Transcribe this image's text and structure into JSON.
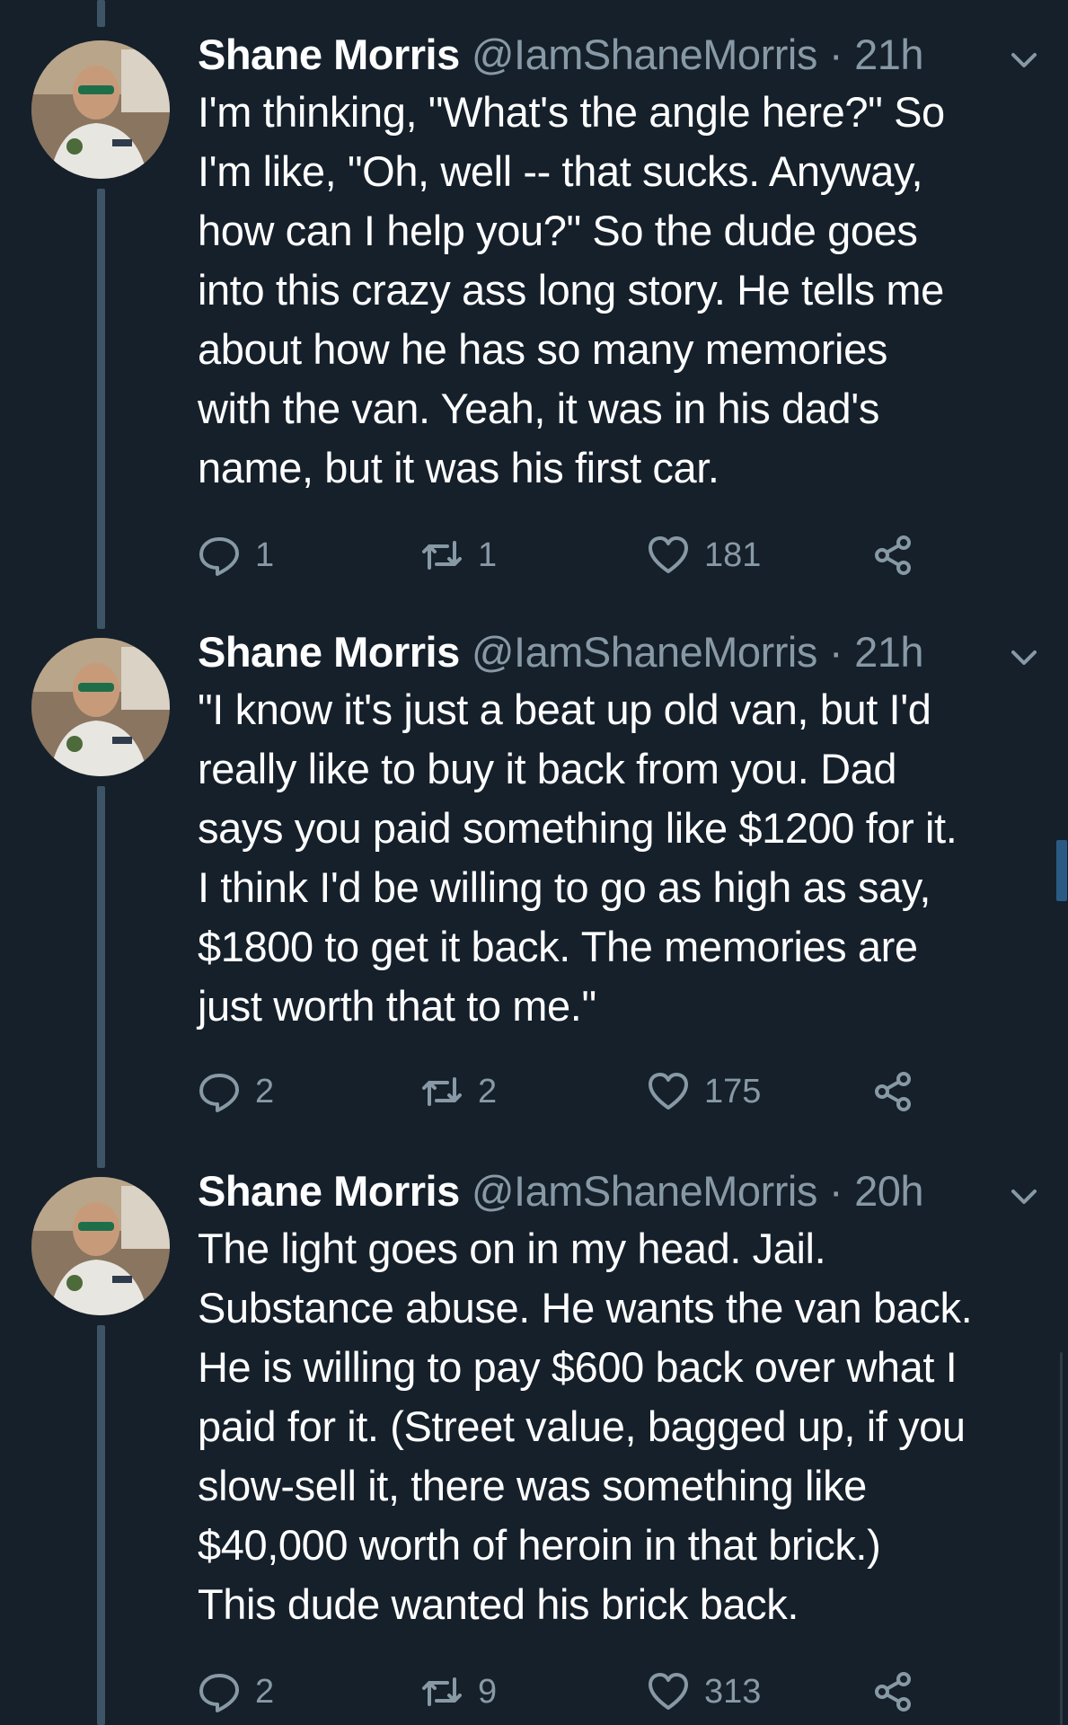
{
  "colors": {
    "background": "#15202b",
    "text": "#ffffff",
    "muted": "#8899a6",
    "thread_line": "#3d5466"
  },
  "tweets": [
    {
      "name": "Shane Morris",
      "handle": "@IamShaneMorris",
      "separator": "·",
      "time": "21h",
      "text": "I'm thinking, \"What's the angle here?\" So\nI'm like, \"Oh, well -- that sucks. Anyway,\nhow can I help you?\" So the dude goes\ninto this crazy ass long story. He tells me\nabout how he has so many memories\nwith the van. Yeah, it was in his dad's\nname, but it was his first car.",
      "replies": "1",
      "retweets": "1",
      "likes": "181"
    },
    {
      "name": "Shane Morris",
      "handle": "@IamShaneMorris",
      "separator": "·",
      "time": "21h",
      "text": "\"I know it's just a beat up old van, but I'd\nreally like to buy it back from you. Dad\nsays you paid something like $1200 for it.\nI think I'd be willing to go as high as say,\n$1800 to get it back. The memories are\njust worth that to me.\"",
      "replies": "2",
      "retweets": "2",
      "likes": "175"
    },
    {
      "name": "Shane Morris",
      "handle": "@IamShaneMorris",
      "separator": "·",
      "time": "20h",
      "text": "The light goes on in my head. Jail.\nSubstance abuse. He wants the van back.\nHe is willing to pay $600 back over what I\npaid for it. (Street value, bagged up, if you\nslow-sell it, there was something like\n$40,000 worth of heroin in that brick.)\nThis dude wanted his brick back.",
      "replies": "2",
      "retweets": "9",
      "likes": "313"
    }
  ],
  "icons": {
    "reply": "reply-icon",
    "retweet": "retweet-icon",
    "like": "heart-icon",
    "share": "share-icon",
    "more": "chevron-down-icon"
  }
}
